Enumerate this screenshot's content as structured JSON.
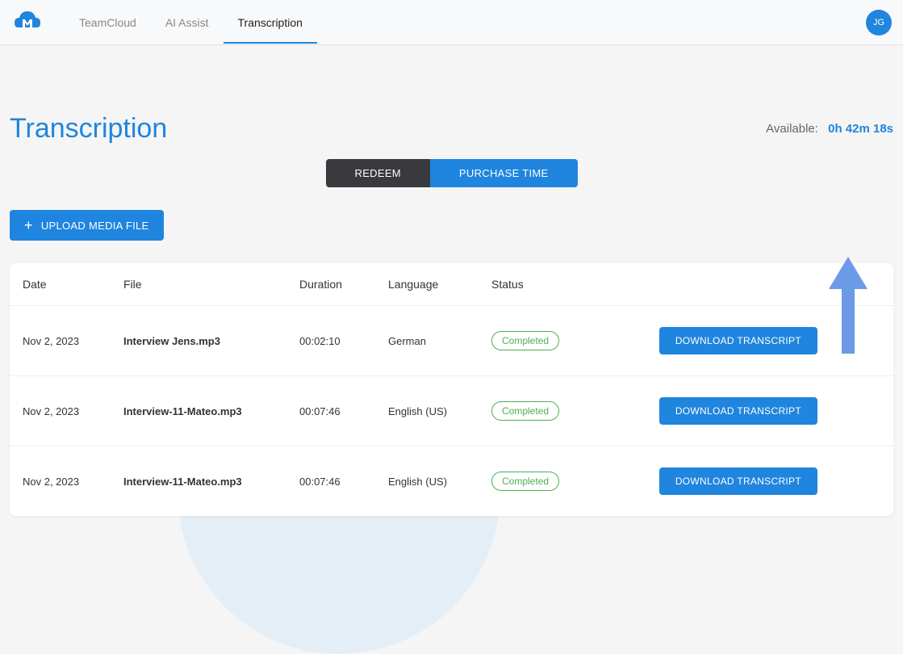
{
  "header": {
    "nav": [
      {
        "label": "TeamCloud",
        "active": false
      },
      {
        "label": "AI Assist",
        "active": false
      },
      {
        "label": "Transcription",
        "active": true
      }
    ],
    "avatar_initials": "JG"
  },
  "page": {
    "title": "Transcription",
    "available_label": "Available:",
    "available_time": "0h 42m 18s"
  },
  "actions": {
    "redeem_label": "REDEEM",
    "purchase_label": "PURCHASE TIME",
    "upload_label": "UPLOAD MEDIA FILE",
    "download_label": "DOWNLOAD TRANSCRIPT"
  },
  "table": {
    "headers": {
      "date": "Date",
      "file": "File",
      "duration": "Duration",
      "language": "Language",
      "status": "Status"
    },
    "rows": [
      {
        "date": "Nov 2, 2023",
        "file": "Interview Jens.mp3",
        "duration": "00:02:10",
        "language": "German",
        "status": "Completed"
      },
      {
        "date": "Nov 2, 2023",
        "file": "Interview-11-Mateo.mp3",
        "duration": "00:07:46",
        "language": "English (US)",
        "status": "Completed"
      },
      {
        "date": "Nov 2, 2023",
        "file": "Interview-11-Mateo.mp3",
        "duration": "00:07:46",
        "language": "English (US)",
        "status": "Completed"
      }
    ]
  }
}
